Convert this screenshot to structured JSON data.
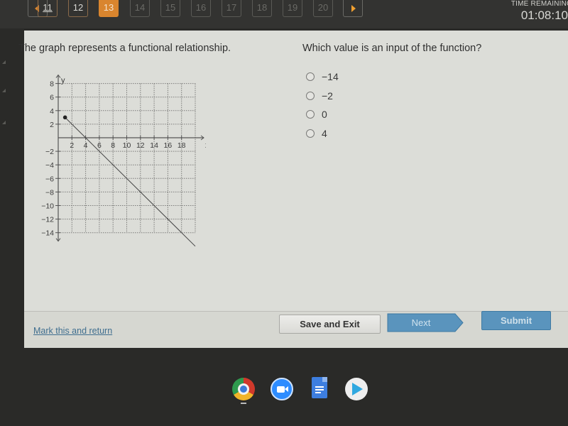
{
  "topbar": {
    "prev_icon": "triangle-left",
    "next_icon": "triangle-right",
    "questions": [
      {
        "label": "11",
        "state": "visited"
      },
      {
        "label": "12",
        "state": "visited"
      },
      {
        "label": "13",
        "state": "current"
      },
      {
        "label": "14",
        "state": "unvisited"
      },
      {
        "label": "15",
        "state": "unvisited"
      },
      {
        "label": "16",
        "state": "unvisited"
      },
      {
        "label": "17",
        "state": "unvisited"
      },
      {
        "label": "18",
        "state": "unvisited"
      },
      {
        "label": "19",
        "state": "unvisited"
      },
      {
        "label": "20",
        "state": "unvisited"
      }
    ],
    "timer_label": "TIME REMAINING",
    "timer_value": "01:08:10",
    "accent_color": "#d9852e"
  },
  "question": {
    "prompt": "The graph represents a functional relationship.",
    "ask": "Which value is an input of the function?",
    "options": [
      {
        "label": "−14",
        "selected": false
      },
      {
        "label": "−2",
        "selected": false
      },
      {
        "label": "0",
        "selected": false
      },
      {
        "label": "4",
        "selected": false
      }
    ]
  },
  "graph": {
    "x_axis_label": "x",
    "y_axis_label": "y",
    "x_ticks": [
      "2",
      "4",
      "6",
      "8",
      "10",
      "12",
      "14",
      "16",
      "18"
    ],
    "y_ticks": [
      "8",
      "6",
      "4",
      "2",
      "−2",
      "−4",
      "−6",
      "−8",
      "−10",
      "−12",
      "−14"
    ],
    "xlim": [
      0,
      20
    ],
    "ylim": [
      -14,
      8
    ],
    "line": {
      "start": [
        1,
        3
      ],
      "start_closed_point": true,
      "slope": -1,
      "passes_through": [
        [
          4,
          0
        ],
        [
          6,
          -2
        ],
        [
          8,
          -4
        ],
        [
          10,
          -6
        ],
        [
          12,
          -8
        ],
        [
          14,
          -10
        ],
        [
          16,
          -12
        ],
        [
          18,
          -14
        ]
      ],
      "extends_beyond": [
        20,
        -16
      ]
    }
  },
  "footer": {
    "mark_link": "Mark this and return",
    "save_label": "Save and Exit",
    "next_label": "Next",
    "submit_label": "Submit",
    "button_color": "#5a94bd"
  },
  "shelf": {
    "apps": [
      "chrome-icon",
      "zoom-icon",
      "google-docs-icon",
      "play-store-icon"
    ]
  }
}
